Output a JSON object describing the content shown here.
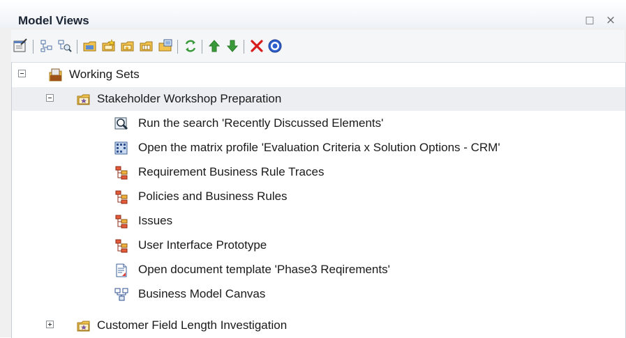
{
  "window": {
    "title": "Model Views",
    "maximize_symbol": "□",
    "close_symbol": "×"
  },
  "toolbar": {
    "buttons": [
      {
        "name": "properties-icon"
      },
      {
        "name": "new-view-icon"
      },
      {
        "name": "new-search-view-icon"
      },
      {
        "name": "new-working-set-icon"
      },
      {
        "name": "new-favorites-icon"
      },
      {
        "name": "new-folder-icon"
      },
      {
        "name": "new-package-icon"
      },
      {
        "name": "new-slideshow-icon"
      },
      {
        "name": "refresh-icon"
      },
      {
        "name": "move-up-icon"
      },
      {
        "name": "move-down-icon"
      },
      {
        "name": "delete-icon"
      },
      {
        "name": "help-icon"
      }
    ],
    "accent_colors": {
      "up": "#3a9a3a",
      "down": "#3a9a3a",
      "delete": "#d81b1b",
      "help": "#2f5fcf"
    }
  },
  "tree": {
    "selected_row_color": "#eceef1",
    "rows": [
      {
        "label": "Working Sets",
        "icon": "working-sets-icon",
        "expander": "minus"
      },
      {
        "label": "Stakeholder Workshop Preparation",
        "icon": "working-set-folder-icon",
        "expander": "minus"
      },
      {
        "label": "Run the search 'Recently Discussed Elements'",
        "icon": "search-icon"
      },
      {
        "label": "Open the matrix profile 'Evaluation Criteria x Solution Options - CRM'",
        "icon": "matrix-icon"
      },
      {
        "label": "Requirement Business Rule Traces",
        "icon": "diagram-icon"
      },
      {
        "label": "Policies and Business Rules",
        "icon": "diagram-icon"
      },
      {
        "label": "Issues",
        "icon": "diagram-icon"
      },
      {
        "label": "User Interface Prototype",
        "icon": "diagram-icon"
      },
      {
        "label": "Open document template 'Phase3 Reqirements'",
        "icon": "document-template-icon"
      },
      {
        "label": "Business Model Canvas",
        "icon": "canvas-diagram-icon"
      },
      {
        "label": "Customer Field Length Investigation",
        "icon": "working-set-folder-icon",
        "expander": "plus"
      }
    ]
  }
}
